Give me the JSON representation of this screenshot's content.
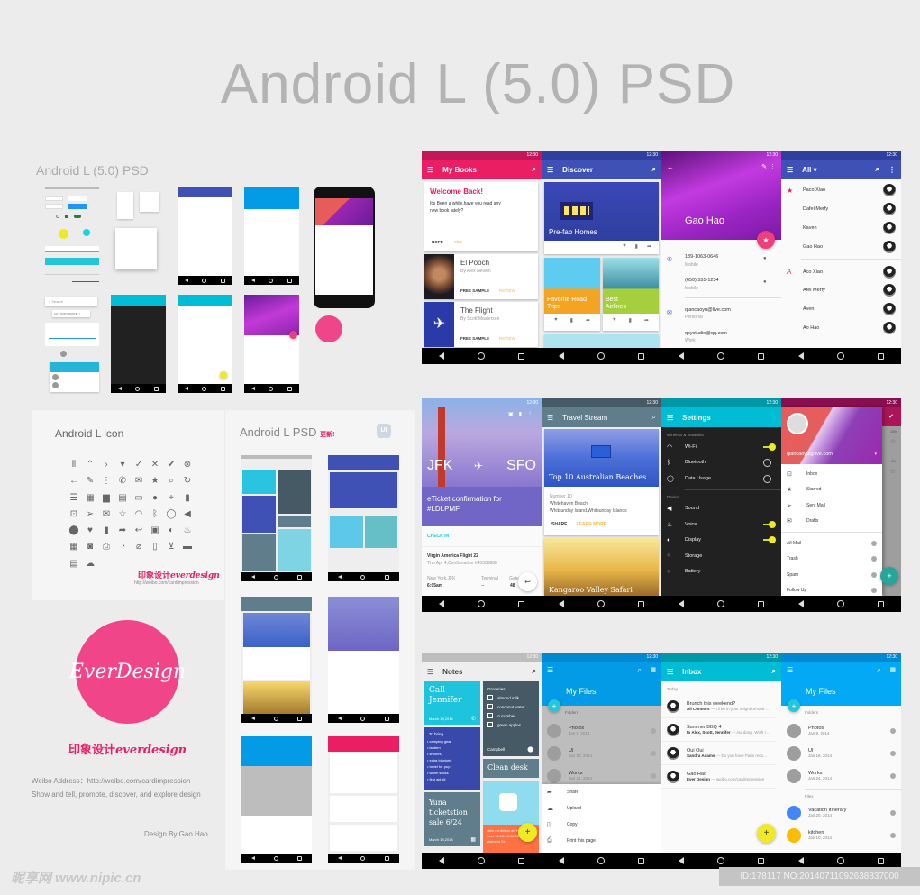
{
  "header": {
    "title": "Android L (5.0) PSD"
  },
  "overview": {
    "title": "Android L (5.0) PSD"
  },
  "icon_panel": {
    "title": "Android L icon",
    "icons": [
      "drag-handle",
      "expand-less",
      "chevron-right",
      "arrow-drop-down",
      "check",
      "close",
      "check-circle",
      "cancel",
      "arrow-back",
      "edit",
      "more-vert",
      "phone",
      "email",
      "star",
      "search",
      "refresh",
      "menu",
      "grid",
      "folder",
      "document",
      "window",
      "info",
      "add",
      "delete",
      "inbox",
      "send",
      "drafts",
      "star-border",
      "wifi",
      "bluetooth",
      "data-usage",
      "volume",
      "place",
      "favorite",
      "bookmark",
      "share",
      "reply",
      "archive",
      "brightness",
      "mic",
      "event",
      "camera",
      "print",
      "timer",
      "notifications-off",
      "clipboard",
      "cart",
      "movie",
      "content-paste",
      "cloud-upload"
    ],
    "glyphs": [
      "⦀",
      "⌃",
      "›",
      "▾",
      "✓",
      "✕",
      "✔",
      "⊗",
      "←",
      "✎",
      "⋮",
      "✆",
      "✉",
      "★",
      "⌕",
      "↻",
      "☰",
      "▦",
      "▆",
      "▤",
      "▭",
      "●",
      "+",
      "▮",
      "⊡",
      "➢",
      "✉",
      "☆",
      "◠",
      "ᛒ",
      "◯",
      "◀",
      "⬤",
      "♥",
      "▮",
      "➦",
      "↩",
      "▣",
      "◐",
      "♨",
      "▦",
      "◙",
      "⎙",
      "◔",
      "⌀",
      "▯",
      "⊻",
      "▬",
      "▤",
      "☁"
    ],
    "brand_cn": "印象设计",
    "brand_en": "everdesign",
    "url": "http://weibo.com/cardimpression"
  },
  "brand": {
    "logo_text": "EverDesign",
    "tagline_cn": "印象设计",
    "tagline_en": "everdesign",
    "weibo": "Weibo Address：http://weibo.com/cardimpression",
    "description": "Show and tell, promote, discover, and explore design",
    "credit": "Design By Gao Hao",
    "color": "#f1458a"
  },
  "psd_panel": {
    "title": "Android L PSD",
    "badge": "更新!",
    "logo": "UI"
  },
  "status_time": "12:30",
  "screens": {
    "my_books": {
      "title": "My Books",
      "color": "#e91e63",
      "welcome_title": "Welcome Back!",
      "welcome_body": "It's Been a while,have you read any new book lately?",
      "nope": "NOPE",
      "yes": "YES",
      "books": [
        {
          "title": "El Pooch",
          "author": "By Alex Nelson",
          "sample": "FREE SAMPLE",
          "review": "REVIEW"
        },
        {
          "title": "The Flight",
          "author": "By Scott Masterson",
          "sample": "FREE SAMPLE",
          "review": "REVIEW"
        }
      ]
    },
    "discover": {
      "title": "Discover",
      "color": "#3f51b5",
      "cards": [
        "Pre-fab Homes",
        "Favorite Road Trips",
        "Best Airlines"
      ]
    },
    "contact": {
      "name": "Gao Hao",
      "phones": [
        {
          "value": "189-1063-0646",
          "type": "Mobile"
        },
        {
          "value": "(650) 555-1234",
          "type": "Mobile"
        }
      ],
      "emails": [
        {
          "value": "qiancaoyu@live.com",
          "type": "Personal"
        },
        {
          "value": "qcystudio@qq.com",
          "type": "Work"
        }
      ]
    },
    "contacts_list": {
      "title": "All",
      "starred": [
        "Paco Xiao",
        "Dafei Merfy",
        "Kaven",
        "Gao Hao"
      ],
      "a_letter": "A",
      "a_group": [
        "Aco Xiao",
        "Afei Merfy",
        "Aven",
        "Ao Hao"
      ]
    },
    "flight": {
      "from": "JFK",
      "to": "SFO",
      "headline": "eTicket confirmation for #LDLPMF",
      "check_in": "CHECK IN",
      "flight_name": "Virgin America Flight 22",
      "flight_detail": "Thu Apr 4,Confirmation #45358886",
      "origin_label": "New York,JFK",
      "origin_time": "6:05am",
      "terminal_label": "Terminal",
      "terminal_value": "--",
      "gate_label": "Gate",
      "gate_value": "48"
    },
    "travel": {
      "title": "Travel Stream",
      "card1_title": "Top 10 Australian Beaches",
      "card1_num": "Number 10",
      "card1_place": "Whitehaven Beach",
      "card1_sub": "Whitsunday Island,Whitsunday Islands",
      "share": "SHARE",
      "learn": "LEARN MORE",
      "card2_title": "Kangaroo Valley Safari"
    },
    "settings": {
      "title": "Settings",
      "section1": "Wireless & networks",
      "items1": [
        {
          "label": "Wi-Fi",
          "on": true
        },
        {
          "label": "Bluetooth",
          "on": false
        },
        {
          "label": "Data Usage",
          "on": false
        }
      ],
      "section2": "Device",
      "items2": [
        {
          "label": "Sound"
        },
        {
          "label": "Voice",
          "on": true
        },
        {
          "label": "Display",
          "on": true
        },
        {
          "label": "Storage"
        },
        {
          "label": "Battery"
        }
      ]
    },
    "mail_drawer": {
      "account": "qiancaoyu@live.com",
      "primary": [
        "Inbox",
        "Starred",
        "Sent Mail",
        "Drafts"
      ],
      "secondary": [
        "All Mail",
        "Trash",
        "Spam",
        "Follow Up"
      ],
      "times": [
        "15m",
        "2h"
      ]
    },
    "notes": {
      "title": "Notes",
      "call": "Call Jennifer",
      "call_date": "March 19,2014",
      "groceries_title": "Groceries:",
      "groceries": [
        "almond milk",
        "conconut water",
        "cucumber",
        "green apples"
      ],
      "location": "Campbell",
      "bring_title": "To bring",
      "bring": [
        "• camping gear",
        "• lantern",
        "• smores",
        "• extra blankets",
        "• towel for pup",
        "• warm socks",
        "• first aid kit"
      ],
      "clean": "Clean desk",
      "yuna": "Yuna ticketstion sale 6/24",
      "yuna_date": "March 19,2014",
      "exhibit": "New exhibition at \"Hood to Love\" 6.28.14-06.28.14 342 Valencia St."
    },
    "files_sheet": {
      "title": "My Files",
      "folders_label": "Folders",
      "folders": [
        {
          "name": "Photos",
          "date": "Jan 9, 2014"
        },
        {
          "name": "UI",
          "date": "Jan 18, 2014"
        },
        {
          "name": "Works",
          "date": "Jan 24, 2014"
        }
      ],
      "sheet": [
        "Share",
        "Upload",
        "Copy",
        "Print this page"
      ]
    },
    "inbox": {
      "title": "Inbox",
      "section": "Today",
      "threads": [
        {
          "subject": "Brunch this weekend?",
          "from": "Ali Connors",
          "snippet": " — I'll be in your neighborhood ..."
        },
        {
          "subject": "Summer BBQ  4",
          "from": "to Alex, Scott, Jennifer",
          "snippet": " — Aw dang. Wish I ..."
        },
        {
          "subject": "Oui Oui",
          "from": "Sandra Adams",
          "snippet": " — Do you have Paris reco..."
        },
        {
          "subject": "Gao Hao",
          "from": "Ever Design",
          "snippet": " — weibo.com/cardimpression"
        }
      ]
    },
    "files": {
      "title": "My Files",
      "folders_label": "Folders",
      "folders": [
        {
          "name": "Photos",
          "date": "Jan 9, 2014"
        },
        {
          "name": "UI",
          "date": "Jan 18, 2014"
        },
        {
          "name": "Works",
          "date": "Jan 24, 2014"
        }
      ],
      "files_label": "Files",
      "files": [
        {
          "name": "Vacation Itinerary",
          "date": "Jan 20, 2014",
          "color": "#4285f4"
        },
        {
          "name": "kitchen",
          "date": "Jan 10, 2014",
          "color": "#fbbc05"
        }
      ]
    }
  },
  "watermark": {
    "site": "昵享网 www.nipic.cn",
    "id": "ID:178117 NO:20140711092638837000"
  }
}
